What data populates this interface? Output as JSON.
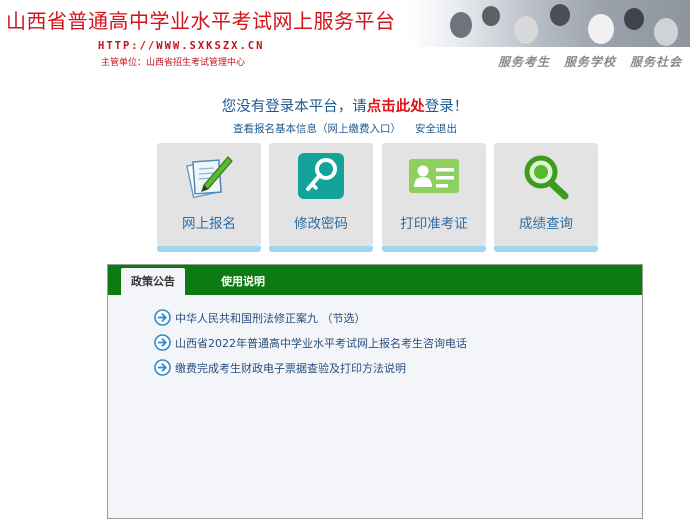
{
  "header": {
    "title": "山西省普通高中学业水平考试网上服务平台",
    "url": "HTTP://WWW.SXKSZX.CN",
    "sponsor": "主管单位：山西省招生考试管理中心",
    "links": [
      "服务考生",
      "服务学校",
      "服务社会"
    ]
  },
  "notice": {
    "prefix": "您没有登录本平台，请",
    "highlight": "点击此处",
    "suffix": "登录！"
  },
  "sublinks": {
    "info": "查看报名基本信息（网上缴费入口）",
    "logout": "安全退出"
  },
  "tiles": [
    {
      "label": "网上报名",
      "icon": "pen-paper-icon"
    },
    {
      "label": "修改密码",
      "icon": "key-icon"
    },
    {
      "label": "打印准考证",
      "icon": "id-card-icon"
    },
    {
      "label": "成绩查询",
      "icon": "magnifier-icon"
    }
  ],
  "panel": {
    "tabs": [
      "政策公告",
      "使用说明"
    ],
    "active_tab": "政策公告",
    "items": [
      "中华人民共和国刑法修正案九 （节选）",
      "山西省2022年普通高中学业水平考试网上报名考生咨询电话",
      "缴费完成考生财政电子票据查验及打印方法说明"
    ]
  },
  "colors": {
    "title_red": "#d4141c",
    "link_blue": "#1f5a8f",
    "tab_green": "#0e7a12",
    "tile_bg": "#e3e3e3",
    "tile_accent": "#9fd6f2"
  }
}
